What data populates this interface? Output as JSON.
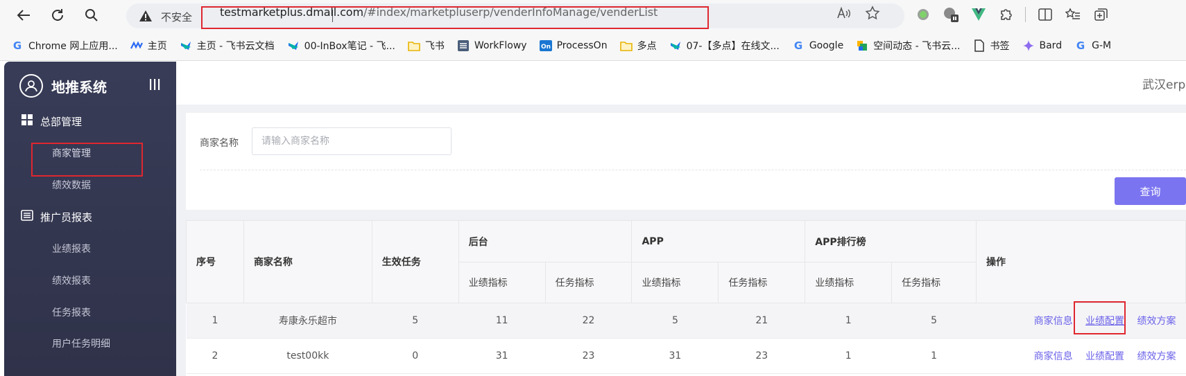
{
  "browser": {
    "insecure_label": "不安全",
    "url_host": "testmarketplus.dmall.com",
    "url_path": "/#index/marketpluserp/venderInfoManage/venderList"
  },
  "bookmarks": [
    {
      "label": "Chrome 网上应用...",
      "icon": "google-icon",
      "color": "#4285f4"
    },
    {
      "label": "主页",
      "icon": "wave-icon",
      "color": "#2b6bf3"
    },
    {
      "label": "主页 - 飞书云文档",
      "icon": "feishu-icon",
      "color": "#1e6cf0"
    },
    {
      "label": "00-InBox笔记 - 飞...",
      "icon": "feishu-icon",
      "color": "#1e6cf0"
    },
    {
      "label": "飞书",
      "icon": "folder-icon",
      "color": "#e8b400"
    },
    {
      "label": "WorkFlowy",
      "icon": "list-icon",
      "color": "#4a5e7a"
    },
    {
      "label": "ProcessOn",
      "icon": "on-icon",
      "color": "#1976d2"
    },
    {
      "label": "多点",
      "icon": "folder-icon",
      "color": "#e8b400"
    },
    {
      "label": "07-【多点】在线文...",
      "icon": "feishu-icon",
      "color": "#1e6cf0"
    },
    {
      "label": "Google",
      "icon": "google-icon",
      "color": "#4285f4"
    },
    {
      "label": "空间动态 - 飞书云...",
      "icon": "space-icon",
      "color": "#22a35a"
    },
    {
      "label": "书签",
      "icon": "page-icon",
      "color": "#333333"
    },
    {
      "label": "Bard",
      "icon": "bard-icon",
      "color": "#8e6cf0"
    },
    {
      "label": "G-M",
      "icon": "google-icon",
      "color": "#4285f4"
    }
  ],
  "sidebar": {
    "title": "地推系统",
    "groups": [
      {
        "label": "总部管理",
        "icon": "grid-icon",
        "items": [
          "商家管理",
          "绩效数据"
        ]
      },
      {
        "label": "推广员报表",
        "icon": "list-icon",
        "items": [
          "业绩报表",
          "绩效报表",
          "任务报表",
          "用户任务明细"
        ]
      }
    ]
  },
  "header": {
    "right_text": "武汉erp"
  },
  "search": {
    "label": "商家名称",
    "placeholder": "请输入商家名称",
    "value": "",
    "query_button": "查询"
  },
  "table": {
    "headers": {
      "index": "序号",
      "name": "商家名称",
      "active_tasks": "生效任务",
      "group_backend": "后台",
      "group_app": "APP",
      "group_rank": "APP排行榜",
      "ops": "操作",
      "sub_perf": "业绩指标",
      "sub_task": "任务指标"
    },
    "rows": [
      {
        "index": "1",
        "name": "寿康永乐超市",
        "active_tasks": "5",
        "backend_perf": "11",
        "backend_task": "22",
        "app_perf": "5",
        "app_task": "21",
        "rank_perf": "1",
        "rank_task": "5"
      },
      {
        "index": "2",
        "name": "test00kk",
        "active_tasks": "0",
        "backend_perf": "31",
        "backend_task": "23",
        "app_perf": "31",
        "app_task": "23",
        "rank_perf": "1",
        "rank_task": "1"
      }
    ],
    "ops": [
      "商家信息",
      "业绩配置",
      "绩效方案"
    ]
  },
  "colors": {
    "sidebar_bg": "#35384f",
    "accent": "#7b74f0",
    "link": "#6b62e8",
    "highlight": "#e0262f"
  }
}
